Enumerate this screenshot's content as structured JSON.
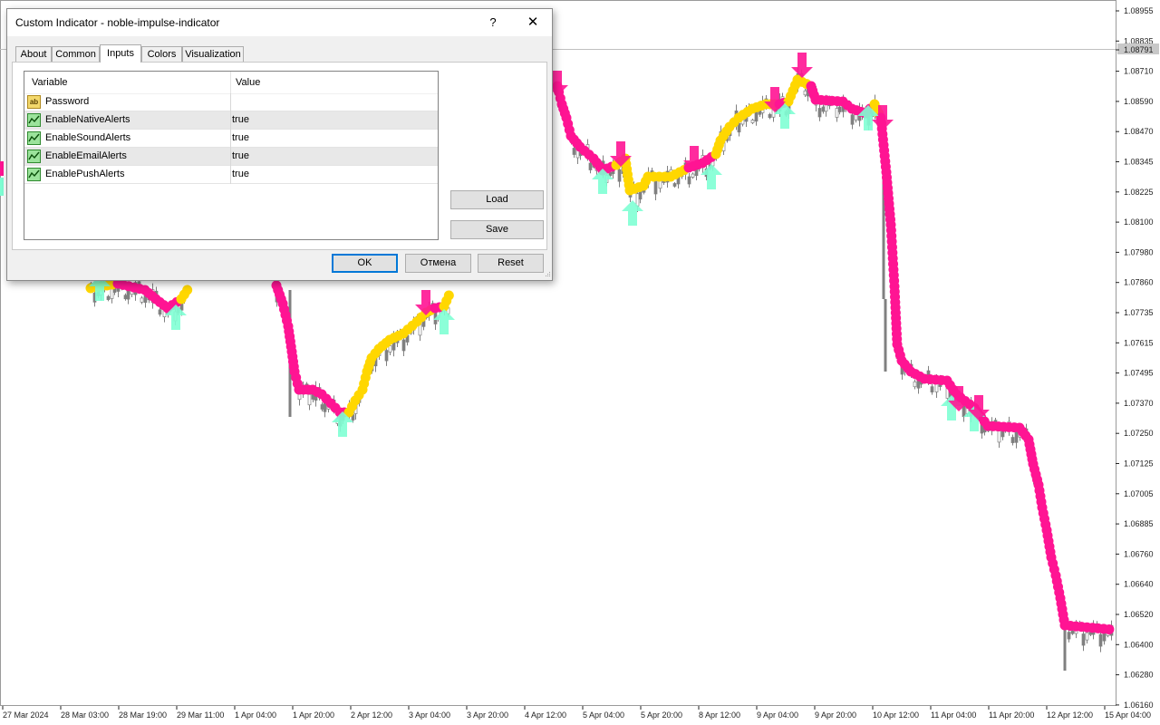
{
  "dialog": {
    "title": "Custom Indicator - noble-impulse-indicator",
    "help_label": "?",
    "close_label": "✕",
    "tabs": [
      {
        "label": "About"
      },
      {
        "label": "Common"
      },
      {
        "label": "Inputs"
      },
      {
        "label": "Colors"
      },
      {
        "label": "Visualization"
      }
    ],
    "active_tab": "Inputs",
    "grid": {
      "columns": [
        "Variable",
        "Value"
      ],
      "rows": [
        {
          "variable": "Password",
          "value": "",
          "icon": "string-param-icon"
        },
        {
          "variable": "EnableNativeAlerts",
          "value": "true",
          "icon": "bool-param-icon"
        },
        {
          "variable": "EnableSoundAlerts",
          "value": "true",
          "icon": "bool-param-icon"
        },
        {
          "variable": "EnableEmailAlerts",
          "value": "true",
          "icon": "bool-param-icon"
        },
        {
          "variable": "EnablePushAlerts",
          "value": "true",
          "icon": "bool-param-icon"
        }
      ]
    },
    "load_label": "Load",
    "save_label": "Save",
    "ok_label": "OK",
    "cancel_label": "Отмена",
    "reset_label": "Reset",
    "string_icon_text": "ab"
  },
  "chart": {
    "price_labels": [
      "1.08955",
      "1.08835",
      "1.08791",
      "1.08710",
      "1.08590",
      "1.08470",
      "1.08345",
      "1.08225",
      "1.08100",
      "1.07980",
      "1.07860",
      "1.07735",
      "1.07615",
      "1.07495",
      "1.07370",
      "1.07250",
      "1.07125",
      "1.07005",
      "1.06885",
      "1.06760",
      "1.06640",
      "1.06520",
      "1.06400",
      "1.06280",
      "1.06160"
    ],
    "current_price": "1.08791",
    "time_labels": [
      "27 Mar 2024",
      "28 Mar 03:00",
      "28 Mar 19:00",
      "29 Mar 11:00",
      "1 Apr 04:00",
      "1 Apr 20:00",
      "2 Apr 12:00",
      "3 Apr 04:00",
      "3 Apr 20:00",
      "4 Apr 12:00",
      "5 Apr 04:00",
      "5 Apr 20:00",
      "8 Apr 12:00",
      "9 Apr 04:00",
      "9 Apr 20:00",
      "10 Apr 12:00",
      "11 Apr 04:00",
      "11 Apr 20:00",
      "12 Apr 12:00",
      "15 Apr 04:00"
    ],
    "colors": {
      "uptrend_dots": "#ffd700",
      "downtrend_dots": "#ff1493",
      "buy_arrow": "#7fffd4",
      "sell_arrow": "#ff1493",
      "candles": "#808080",
      "current_price_line": "#c0c0c0",
      "axis": "#222222"
    }
  }
}
